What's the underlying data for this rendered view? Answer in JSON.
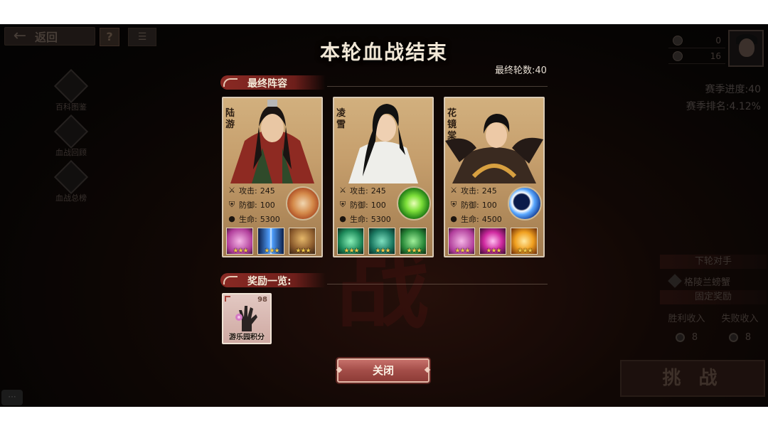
{
  "background": {
    "back_label": "返回",
    "help_label": "?",
    "side_menu": [
      {
        "label": "百科图鉴",
        "icon": "encyclopedia-icon"
      },
      {
        "label": "血战回顾",
        "icon": "battle-review-icon"
      },
      {
        "label": "血战总榜",
        "icon": "leaderboard-icon"
      }
    ],
    "resources": [
      {
        "icon": "drop-icon",
        "value": "0"
      },
      {
        "icon": "coin-icon",
        "value": "16"
      }
    ],
    "season_progress": "赛季进度:40",
    "season_rank": "赛季排名:4.12%",
    "next_opponent_title": "下轮对手",
    "next_opponent_name": "格陵兰螃蟹",
    "fixed_reward_title": "固定奖励",
    "win_income_label": "胜利收入",
    "lose_income_label": "失败收入",
    "win_income_value": "8",
    "lose_income_value": "8",
    "challenge_label": "挑 战",
    "chat_label": "···",
    "background_char": "战"
  },
  "dialog": {
    "title": "本轮血战结束",
    "final_rounds": "最终轮数:40",
    "lineup_title": "最终阵容",
    "rewards_title": "奖励一览:",
    "close_label": "关闭",
    "attack_label": "攻击:",
    "defense_label": "防御:",
    "hp_label": "生命:",
    "heroes": [
      {
        "name": "陆游",
        "attack": "245",
        "defense": "100",
        "hp": "5300",
        "skill_icon": "fist-skill-icon",
        "passives": [
          {
            "icon": "pink-flower-icon",
            "stars": 3
          },
          {
            "icon": "blue-light-icon",
            "stars": 3
          },
          {
            "icon": "golden-figure-icon",
            "stars": 3
          }
        ]
      },
      {
        "name": "凌雪",
        "attack": "245",
        "defense": "100",
        "hp": "5300",
        "skill_icon": "green-burst-skill-icon",
        "passives": [
          {
            "icon": "green-skull-icon",
            "stars": 3
          },
          {
            "icon": "green-mask-icon",
            "stars": 3
          },
          {
            "icon": "green-claw-icon",
            "stars": 3
          }
        ]
      },
      {
        "name": "花镜棠",
        "attack": "245",
        "defense": "100",
        "hp": "4500",
        "skill_icon": "blue-moon-skill-icon",
        "passives": [
          {
            "icon": "pink-flower-icon",
            "stars": 3
          },
          {
            "icon": "magenta-burst-icon",
            "stars": 3
          },
          {
            "icon": "golden-flame-icon",
            "stars": 3
          }
        ]
      }
    ],
    "rewards": [
      {
        "name": "游乐园积分",
        "count": "98",
        "icon": "flower-hand-icon"
      }
    ]
  }
}
